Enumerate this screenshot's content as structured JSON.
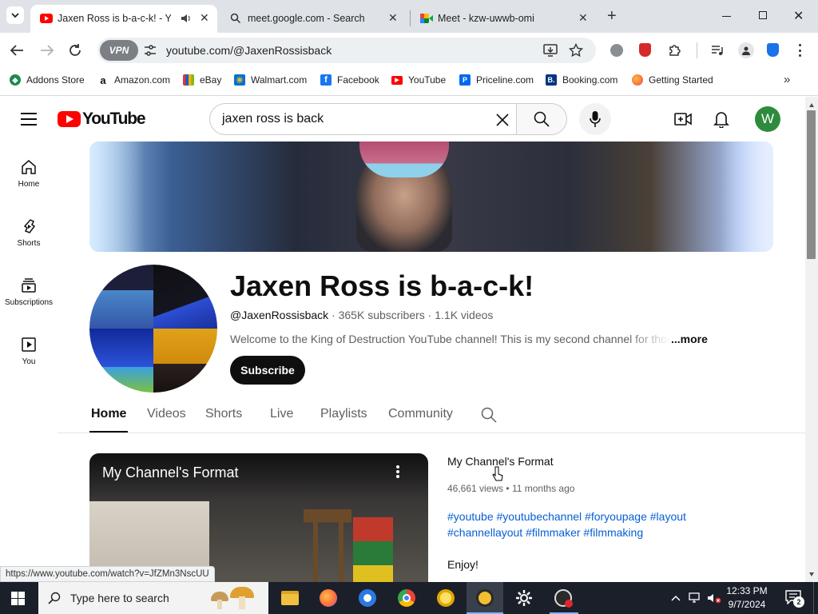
{
  "browser": {
    "tabs": [
      {
        "title": "Jaxen Ross is b-a-c-k! - You",
        "active": true
      },
      {
        "title": "meet.google.com - Search",
        "active": false
      },
      {
        "title": "Meet - kzw-uwwb-omi",
        "active": false
      }
    ],
    "url": "youtube.com/@JaxenRossisback",
    "vpn_label": "VPN",
    "bookmarks": [
      {
        "label": "Addons Store",
        "icon": "addons-store-icon",
        "color": "#1a8a4a"
      },
      {
        "label": "Amazon.com",
        "icon": "amazon-icon",
        "color": "#111111"
      },
      {
        "label": "eBay",
        "icon": "ebay-icon",
        "color": "#e53238"
      },
      {
        "label": "Walmart.com",
        "icon": "walmart-icon",
        "color": "#0071ce"
      },
      {
        "label": "Facebook",
        "icon": "facebook-icon",
        "color": "#1877f2"
      },
      {
        "label": "YouTube",
        "icon": "youtube-icon",
        "color": "#ff0000"
      },
      {
        "label": "Priceline.com",
        "icon": "priceline-icon",
        "color": "#0068ef"
      },
      {
        "label": "Booking.com",
        "icon": "booking-icon",
        "color": "#003580"
      },
      {
        "label": "Getting Started",
        "icon": "firefox-icon",
        "color": "#ff7139"
      }
    ],
    "status_url": "https://www.youtube.com/watch?v=JfZMn3NscUU"
  },
  "youtube": {
    "logo_text": "YouTube",
    "search_value": "jaxen ross is back",
    "avatar_letter": "W",
    "avatar_color": "#2e8b3d",
    "sidebar": [
      {
        "label": "Home",
        "icon": "home-icon"
      },
      {
        "label": "Shorts",
        "icon": "shorts-icon"
      },
      {
        "label": "Subscriptions",
        "icon": "subscriptions-icon"
      },
      {
        "label": "You",
        "icon": "you-icon"
      }
    ],
    "channel": {
      "name": "Jaxen Ross is b-a-c-k!",
      "handle": "@JaxenRossisback",
      "subscribers": "365K subscribers",
      "videos": "1.1K videos",
      "description": "Welcome to the King of Destruction YouTube channel! This is my second channel for those",
      "more": "...more",
      "subscribe_label": "Subscribe"
    },
    "tabs": [
      "Home",
      "Videos",
      "Shorts",
      "Live",
      "Playlists",
      "Community"
    ],
    "active_tab": "Home",
    "featured": {
      "thumb_title": "My Channel's Format",
      "title": "My Channel's Format",
      "views": "46,661 views",
      "age": "11 months ago",
      "hashtags_line1": "#youtube #youtubechannel #foryoupage #layout",
      "hashtags_line2": "#channellayout #filmmaker #filmmaking",
      "body": "Enjoy!"
    }
  },
  "taskbar": {
    "search_placeholder": "Type here to search",
    "time": "12:33 PM",
    "date": "9/7/2024",
    "notification_count": "2"
  },
  "colors": {
    "tab_strip": "#dfe3e8",
    "youtube_red": "#ff0000",
    "link_blue": "#065fd4",
    "taskbar": "#1b1f2a"
  }
}
